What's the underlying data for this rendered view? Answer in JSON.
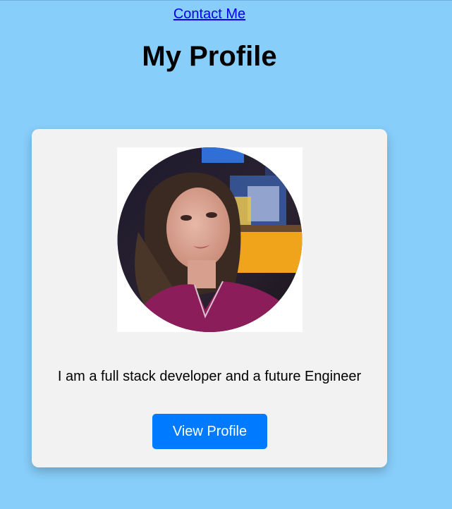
{
  "nav": {
    "contact_label": "Contact Me"
  },
  "header": {
    "title": "My Profile"
  },
  "card": {
    "bio": "I am a full stack developer and a future Engineer",
    "button_label": "View Profile"
  },
  "colors": {
    "page_background": "#87cefa",
    "card_background": "#f2f2f2",
    "button_background": "#007bff",
    "link": "#0000ee"
  }
}
